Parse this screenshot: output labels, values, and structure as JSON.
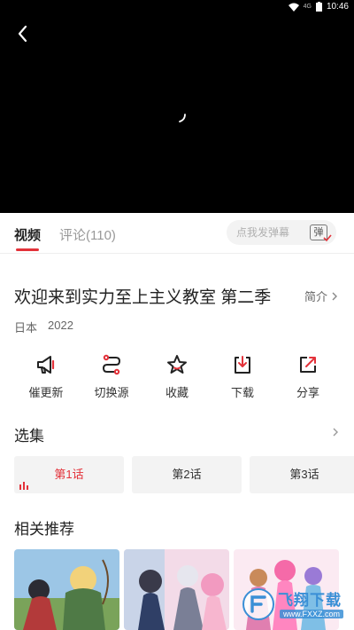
{
  "status_bar": {
    "time": "10:46",
    "network_label": "4G"
  },
  "tabs": [
    {
      "label": "视频",
      "active": true
    },
    {
      "label": "评论(110)",
      "active": false
    }
  ],
  "danmu": {
    "placeholder": "点我发弹幕",
    "toggle_label": "弹"
  },
  "show": {
    "title": "欢迎来到实力至上主义教室 第二季",
    "intro_label": "简介",
    "region": "日本",
    "year": "2022"
  },
  "actions": [
    {
      "label": "催更新",
      "icon": "megaphone-icon"
    },
    {
      "label": "切换源",
      "icon": "switch-source-icon"
    },
    {
      "label": "收藏",
      "icon": "star-icon"
    },
    {
      "label": "下载",
      "icon": "download-icon"
    },
    {
      "label": "分享",
      "icon": "share-icon"
    }
  ],
  "episodes": {
    "heading": "选集",
    "items": [
      {
        "label": "第1话",
        "active": true
      },
      {
        "label": "第2话",
        "active": false
      },
      {
        "label": "第3话",
        "active": false
      }
    ]
  },
  "recommend": {
    "heading": "相关推荐"
  },
  "watermark": {
    "text": "飞翔下载",
    "url": "www.FXXZ.com"
  },
  "colors": {
    "accent": "#e3323a",
    "player_bg": "#000000",
    "chip_bg": "#f3f3f3"
  }
}
